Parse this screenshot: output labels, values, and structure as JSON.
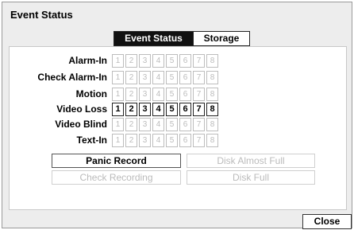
{
  "dialog": {
    "title": "Event Status"
  },
  "tabs": [
    {
      "label": "Event Status",
      "active": true
    },
    {
      "label": "Storage",
      "active": false
    }
  ],
  "channels": [
    "1",
    "2",
    "3",
    "4",
    "5",
    "6",
    "7",
    "8"
  ],
  "event_rows": [
    {
      "label": "Alarm-In",
      "active_channels": []
    },
    {
      "label": "Check Alarm-In",
      "active_channels": []
    },
    {
      "label": "Motion",
      "active_channels": []
    },
    {
      "label": "Video Loss",
      "active_channels": [
        "1",
        "2",
        "3",
        "4",
        "5",
        "6",
        "7",
        "8"
      ]
    },
    {
      "label": "Video Blind",
      "active_channels": []
    },
    {
      "label": "Text-In",
      "active_channels": []
    }
  ],
  "status_buttons": {
    "panic_record": {
      "label": "Panic Record",
      "active": true
    },
    "disk_almost_full": {
      "label": "Disk Almost Full",
      "active": false
    },
    "check_recording": {
      "label": "Check Recording",
      "active": false
    },
    "disk_full": {
      "label": "Disk Full",
      "active": false
    }
  },
  "close_label": "Close"
}
